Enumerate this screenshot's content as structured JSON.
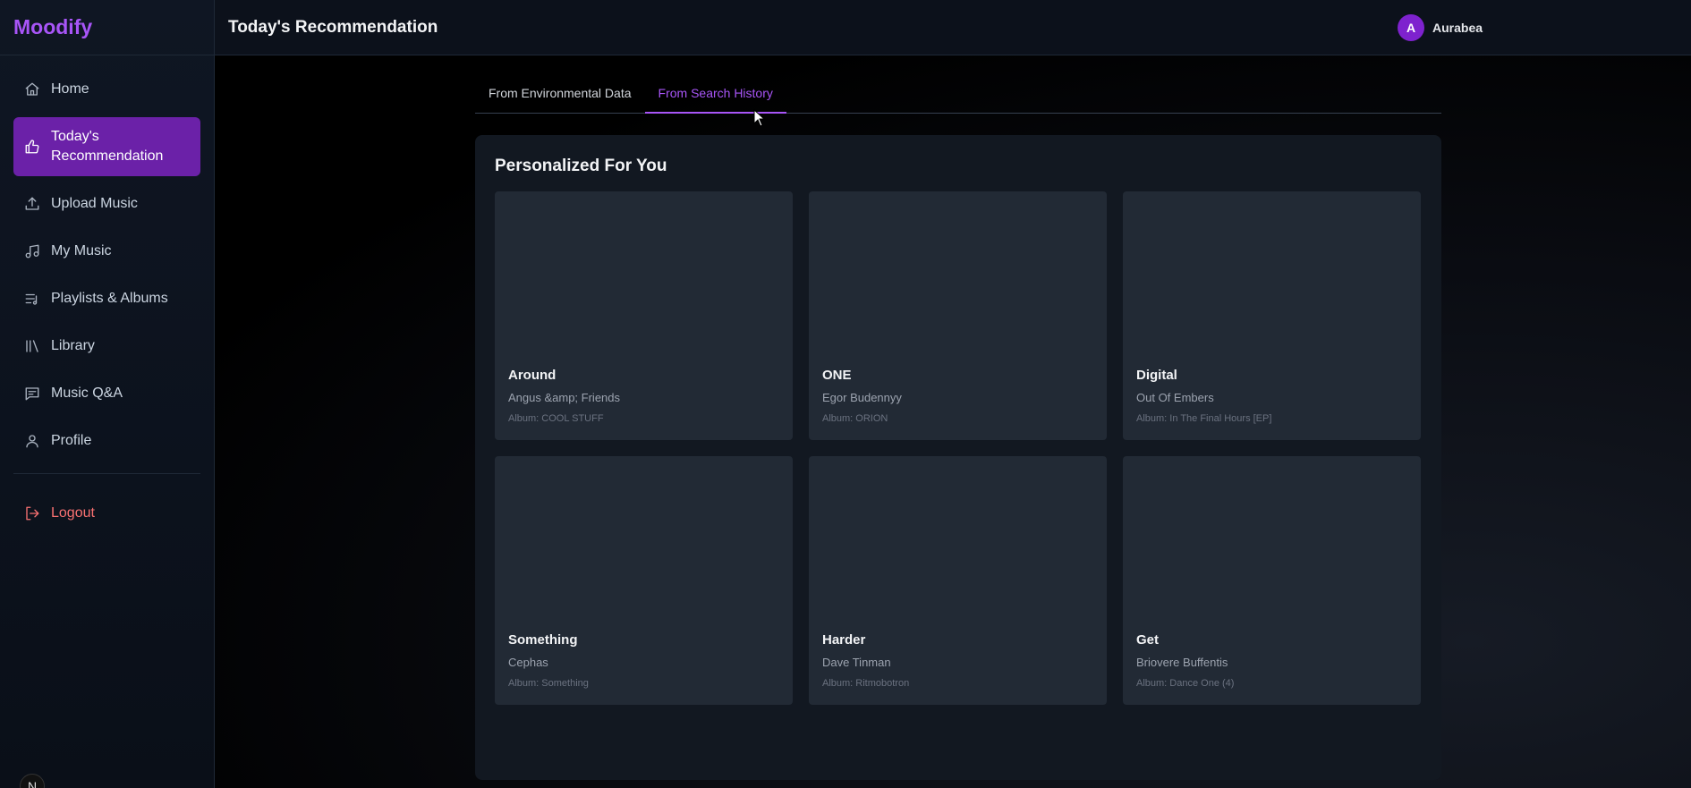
{
  "app": {
    "brand": "Moodify"
  },
  "sidebar": {
    "items": [
      {
        "label": "Home",
        "icon": "home-icon"
      },
      {
        "label": "Today's Recommendation",
        "icon": "thumbs-up-icon",
        "active": true
      },
      {
        "label": "Upload Music",
        "icon": "upload-icon"
      },
      {
        "label": "My Music",
        "icon": "music-note-icon"
      },
      {
        "label": "Playlists & Albums",
        "icon": "playlist-icon"
      },
      {
        "label": "Library",
        "icon": "library-icon"
      },
      {
        "label": "Music Q&A",
        "icon": "chat-icon"
      },
      {
        "label": "Profile",
        "icon": "user-icon"
      }
    ],
    "logout_label": "Logout",
    "badge": "N"
  },
  "header": {
    "title": "Today's Recommendation",
    "user_initial": "A",
    "user_name": "Aurabea"
  },
  "tabs": [
    {
      "label": "From Environmental Data",
      "active": false
    },
    {
      "label": "From Search History",
      "active": true
    }
  ],
  "main": {
    "section_title": "Personalized For You",
    "cards": [
      {
        "title": "Around",
        "artist": "Angus &amp; Friends",
        "album": "Album: COOL STUFF"
      },
      {
        "title": "ONE",
        "artist": "Egor Budennyy",
        "album": "Album: ORION"
      },
      {
        "title": "Digital",
        "artist": "Out Of Embers",
        "album": "Album: In The Final Hours [EP]"
      },
      {
        "title": "Something",
        "artist": "Cephas",
        "album": "Album: Something"
      },
      {
        "title": "Harder",
        "artist": "Dave Tinman",
        "album": "Album: Ritmobotron"
      },
      {
        "title": "Get",
        "artist": "Briovere Buffentis",
        "album": "Album: Dance One (4)"
      }
    ]
  },
  "colors": {
    "accent": "#a855f7",
    "active_nav_bg": "#6b21a8",
    "logout": "#f87171"
  }
}
